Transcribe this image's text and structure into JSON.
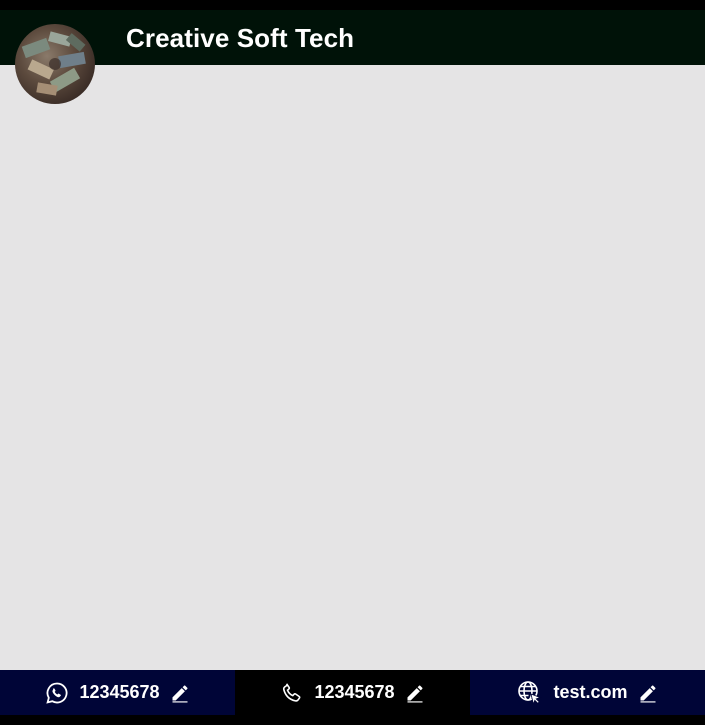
{
  "header": {
    "title": "Creative Soft Tech",
    "background": "#001208"
  },
  "canvas": {
    "background": "#e5e4e5"
  },
  "footer": {
    "items": [
      {
        "label": "12345678",
        "icon": "whatsapp-icon",
        "edit_icon": "pencil-icon",
        "background": "#000537"
      },
      {
        "label": "12345678",
        "icon": "phone-icon",
        "edit_icon": "pencil-icon",
        "background": "#000000"
      },
      {
        "label": "test.com",
        "icon": "globe-cursor-icon",
        "edit_icon": "pencil-icon",
        "background": "#000537"
      }
    ]
  }
}
